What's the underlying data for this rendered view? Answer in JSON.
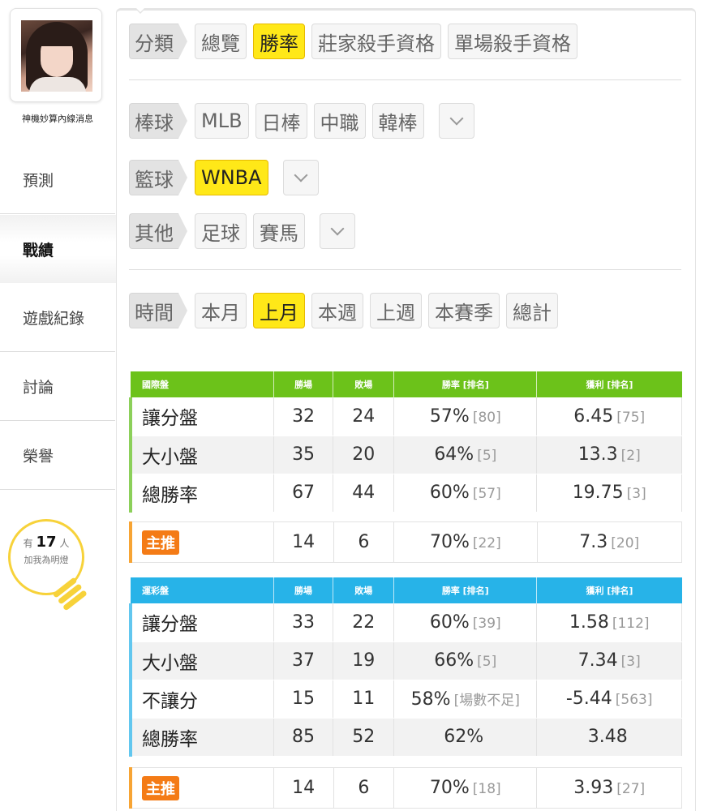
{
  "sidebar": {
    "username": "神機妙算內線消息",
    "nav": [
      {
        "label": "預測"
      },
      {
        "label": "戰績"
      },
      {
        "label": "遊戲紀錄"
      },
      {
        "label": "討論"
      },
      {
        "label": "榮譽"
      }
    ],
    "bulb": {
      "prefix": "有",
      "count": "17",
      "suffix": "人",
      "line2": "加我為明燈"
    }
  },
  "filters": {
    "category": {
      "label": "分類",
      "options": [
        "總覽",
        "勝率",
        "莊家殺手資格",
        "單場殺手資格"
      ],
      "selected": "勝率"
    },
    "baseball": {
      "label": "棒球",
      "options": [
        "MLB",
        "日棒",
        "中職",
        "韓棒"
      ]
    },
    "basketball": {
      "label": "籃球",
      "options": [
        "WNBA"
      ],
      "selected": "WNBA"
    },
    "other": {
      "label": "其他",
      "options": [
        "足球",
        "賽馬"
      ]
    },
    "time": {
      "label": "時間",
      "options": [
        "本月",
        "上月",
        "本週",
        "上週",
        "本賽季",
        "總計"
      ],
      "selected": "上月"
    }
  },
  "table_intl": {
    "headers": [
      "國際盤",
      "勝場",
      "敗場",
      "勝率 [排名]",
      "獲利 [排名]"
    ],
    "rows": [
      {
        "name": "讓分盤",
        "win": "32",
        "loss": "24",
        "rate": "57%",
        "rate_rank": "[80]",
        "profit": "6.45",
        "profit_rank": "[75]"
      },
      {
        "name": "大小盤",
        "win": "35",
        "loss": "20",
        "rate": "64%",
        "rate_rank": "[5]",
        "profit": "13.3",
        "profit_rank": "[2]"
      },
      {
        "name": "總勝率",
        "win": "67",
        "loss": "44",
        "rate": "60%",
        "rate_rank": "[57]",
        "profit": "19.75",
        "profit_rank": "[3]"
      }
    ],
    "pick": {
      "badge": "主推",
      "win": "14",
      "loss": "6",
      "rate": "70%",
      "rate_rank": "[22]",
      "profit": "7.3",
      "profit_rank": "[20]"
    }
  },
  "table_sports": {
    "headers": [
      "運彩盤",
      "勝場",
      "敗場",
      "勝率 [排名]",
      "獲利 [排名]"
    ],
    "rows": [
      {
        "name": "讓分盤",
        "win": "33",
        "loss": "22",
        "rate": "60%",
        "rate_rank": "[39]",
        "profit": "1.58",
        "profit_rank": "[112]"
      },
      {
        "name": "大小盤",
        "win": "37",
        "loss": "19",
        "rate": "66%",
        "rate_rank": "[5]",
        "profit": "7.34",
        "profit_rank": "[3]"
      },
      {
        "name": "不讓分",
        "win": "15",
        "loss": "11",
        "rate": "58%",
        "rate_rank": "[場數不足]",
        "profit": "-5.44",
        "profit_rank": "[563]"
      },
      {
        "name": "總勝率",
        "win": "85",
        "loss": "52",
        "rate": "62%",
        "rate_rank": "",
        "profit": "3.48",
        "profit_rank": ""
      }
    ],
    "pick": {
      "badge": "主推",
      "win": "14",
      "loss": "6",
      "rate": "70%",
      "rate_rank": "[18]",
      "profit": "3.93",
      "profit_rank": "[27]"
    }
  },
  "colors": {
    "intl_header": "#6cc21a",
    "sports_header": "#27b3e8",
    "selected": "#ffe818",
    "pick_badge": "#f47b16",
    "bulb": "#f7d23a"
  }
}
